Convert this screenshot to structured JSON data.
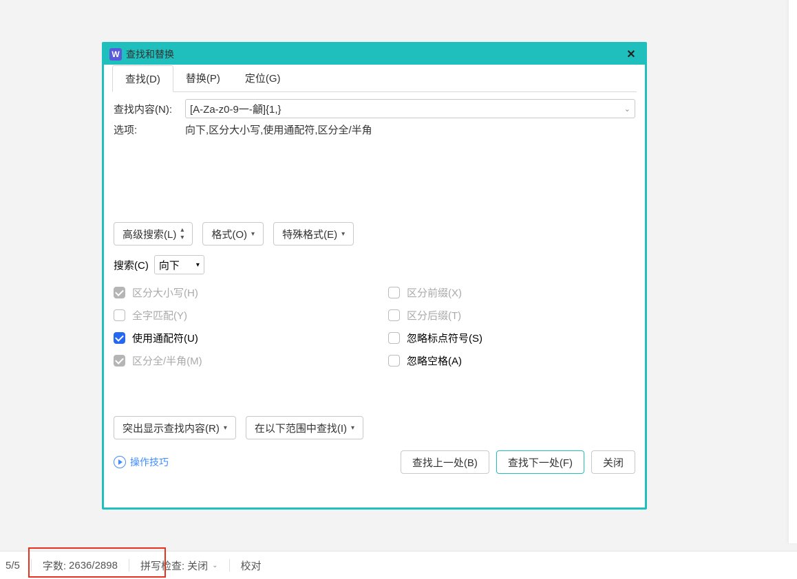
{
  "dialog": {
    "title": "查找和替换",
    "app_letter": "W",
    "tabs": {
      "find": "查找(D)",
      "replace": "替换(P)",
      "goto": "定位(G)"
    },
    "find_label": "查找内容(N):",
    "find_value": "[A-Za-z0-9一-龥]{1,}",
    "options_label": "选项:",
    "options_value": "向下,区分大小写,使用通配符,区分全/半角",
    "adv_search": "高级搜索(L)",
    "format_btn": "格式(O)",
    "special_btn": "特殊格式(E)",
    "search_label": "搜索(C)",
    "search_dir": "向下",
    "checks": {
      "case": "区分大小写(H)",
      "prefix": "区分前缀(X)",
      "whole": "全字匹配(Y)",
      "suffix": "区分后缀(T)",
      "wildcard": "使用通配符(U)",
      "punct": "忽略标点符号(S)",
      "fullhalf": "区分全/半角(M)",
      "space": "忽略空格(A)"
    },
    "highlight_btn": "突出显示查找内容(R)",
    "findin_btn": "在以下范围中查找(I)",
    "tips": "操作技巧",
    "find_prev": "查找上一处(B)",
    "find_next": "查找下一处(F)",
    "close": "关闭"
  },
  "status": {
    "page": "5/5",
    "wordcount_label": "字数:",
    "wordcount": "2636/2898",
    "spell_label": "拼写检查:",
    "spell_state": "关闭",
    "proof": "校对"
  }
}
